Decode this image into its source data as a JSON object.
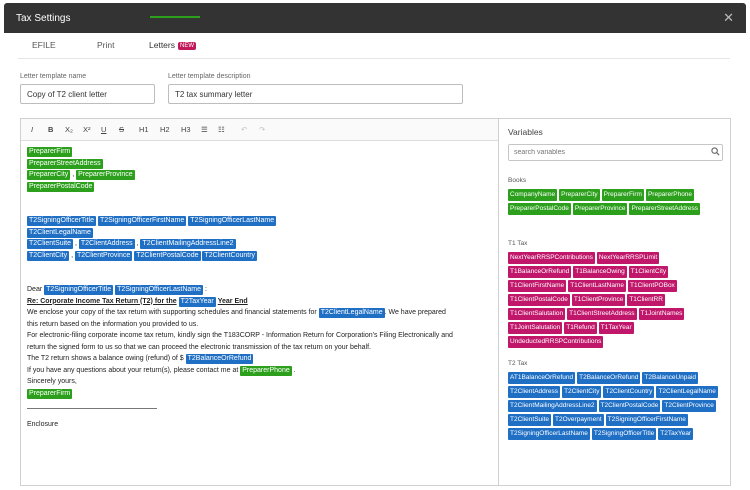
{
  "dialog": {
    "title": "Tax Settings"
  },
  "tabs": [
    {
      "label": "EFILE"
    },
    {
      "label": "Print"
    },
    {
      "label": "Letters",
      "badge": "NEW"
    }
  ],
  "form": {
    "template_name_label": "Letter template name",
    "template_name_value": "Copy of T2 client letter",
    "template_desc_label": "Letter template description",
    "template_desc_value": "T2 tax summary letter"
  },
  "toolbar": [
    "I",
    "B",
    "X₂",
    "X²",
    "U",
    "S",
    "H1",
    "H2",
    "H3",
    "☰",
    "☷",
    "↶",
    "↷"
  ],
  "letter": {
    "preparer_firm": "PreparerFirm",
    "preparer_street": "PreparerStreetAddress",
    "preparer_city": "PreparerCity",
    "preparer_province": "PreparerProvince",
    "preparer_postal": "PreparerPostalCode",
    "signing_title": "T2SigningOfficerTitle",
    "signing_first": "T2SigningOfficerFirstName",
    "signing_last": "T2SigningOfficerLastName",
    "client_legal": "T2ClientLegalName",
    "client_suite": "T2ClientSuite",
    "client_address": "T2ClientAddress",
    "client_mailing2": "T2ClientMailingAddressLine2",
    "client_city": "T2ClientCity",
    "client_province": "T2ClientProvince",
    "client_postal": "T2ClientPostalCode",
    "client_country": "T2ClientCountry",
    "dear": "Dear",
    "re_text": "Re: Corporate Income Tax Return (T2) for the",
    "tax_year": "T2TaxYear",
    "year_end": "Year End",
    "para1a": "We enclose your copy of the tax return with supporting schedules and financial statements for",
    "para1b": ". We have prepared",
    "para1c": "this return based on the information you provided to us.",
    "para2a": "For electronic-filing corporate income tax return, kindly sign the T183CORP - Information Return for Corporation's Filing Electronically and",
    "para2b": "return the signed form to us so that we can proceed the electronic transmission of the tax return on your behalf.",
    "balance_text": "The T2 return shows a balance owing (refund) of $",
    "balance_var": "T2BalanceOrRefund",
    "questions_text": "If you have any questions about your return(s), please contact me at",
    "preparer_phone": "PreparerPhone",
    "sincerely": "Sincerely yours,",
    "enclosure": "Enclosure"
  },
  "variables": {
    "title": "Variables",
    "search_placeholder": "search variables",
    "groups": [
      {
        "name": "Books",
        "color": "#2ca01c",
        "items": [
          "CompanyName",
          "PreparerCity",
          "PreparerFirm",
          "PreparerPhone",
          "PreparerPostalCode",
          "PreparerProvince",
          "PreparerStreetAddress"
        ]
      },
      {
        "name": "T1 Tax",
        "color": "#c0176b",
        "items": [
          "NextYearRRSPContributions",
          "NextYearRRSPLimit",
          "T1BalanceOrRefund",
          "T1BalanceOwing",
          "T1ClientCity",
          "T1ClientFirstName",
          "T1ClientLastName",
          "T1ClientPOBox",
          "T1ClientPostalCode",
          "T1ClientProvince",
          "T1ClientRR",
          "T1ClientSalutation",
          "T1ClientStreetAddress",
          "T1JointNames",
          "T1JointSalutation",
          "T1Refund",
          "T1TaxYear",
          "UndeductedRRSPContributions"
        ]
      },
      {
        "name": "T2 Tax",
        "color": "#1f6fc5",
        "items": [
          "AT1BalanceOrRefund",
          "T2BalanceOrRefund",
          "T2BalanceUnpaid",
          "T2ClientAddress",
          "T2ClientCity",
          "T2ClientCountry",
          "T2ClientLegalName",
          "T2ClientMailingAddressLine2",
          "T2ClientPostalCode",
          "T2ClientProvince",
          "T2ClientSuite",
          "T2Overpayment",
          "T2SigningOfficerFirstName",
          "T2SigningOfficerLastName",
          "T2SigningOfficerTitle",
          "T2TaxYear"
        ]
      }
    ]
  }
}
